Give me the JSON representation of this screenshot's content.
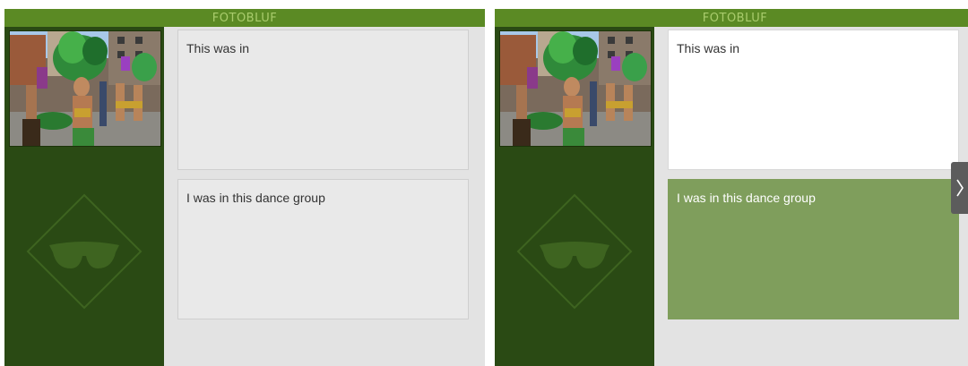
{
  "app": {
    "title": "FOTOBLUF"
  },
  "colors": {
    "titlebar": "#5b8a24",
    "sidebar": "#2a4a14",
    "content_bg": "#e3e3e3",
    "answer_default": "#e9e9e9",
    "answer_white": "#ffffff",
    "answer_selected": "#7f9e5c"
  },
  "question": {
    "photo": "carnival-dancer-photo",
    "logo_icon": "sunglasses-diamond-icon"
  },
  "answers": [
    {
      "label": "This was in"
    },
    {
      "label": "I was in this dance group"
    }
  ],
  "screens": [
    {
      "state": "unanswered"
    },
    {
      "state": "selected",
      "selected_answer": 2
    }
  ],
  "navigation": {
    "next_icon": "chevron-right-icon"
  }
}
